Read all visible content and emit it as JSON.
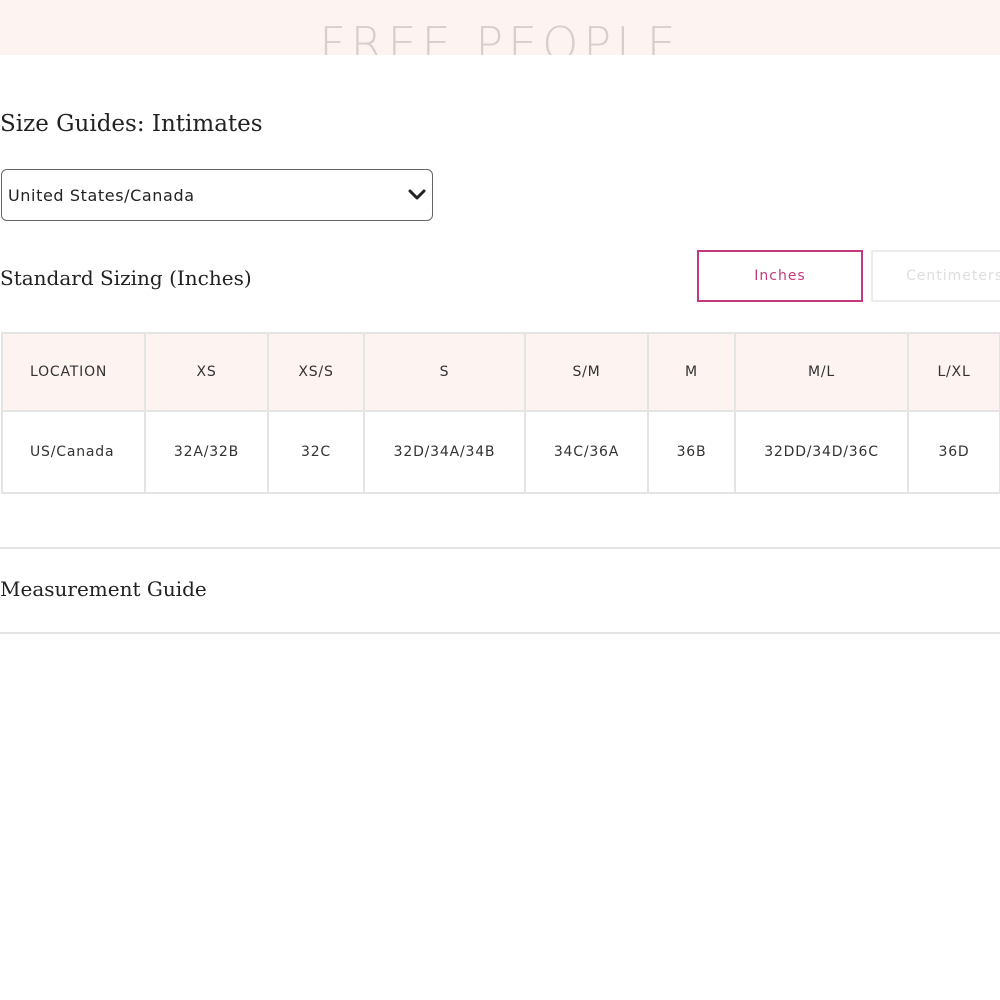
{
  "header": {
    "brand": "FREE PEOPLE"
  },
  "page": {
    "title": "Size Guides: Intimates"
  },
  "region_select": {
    "selected": "United States/Canada",
    "icon": "chevron-down-icon"
  },
  "sizing": {
    "section_title": "Standard Sizing (Inches)",
    "units": [
      {
        "label": "Inches",
        "active": true
      },
      {
        "label": "Centimeters",
        "active": false
      }
    ],
    "accent_color": "#c43a7e",
    "header_bg": "#fdf3f1"
  },
  "table": {
    "columns": [
      "LOCATION",
      "XS",
      "XS/S",
      "S",
      "S/M",
      "M",
      "M/L",
      "L/XL"
    ],
    "rows": [
      [
        "US/Canada",
        "32A/32B",
        "32C",
        "32D/34A/34B",
        "34C/36A",
        "36B",
        "32DD/34D/36C",
        "36D"
      ]
    ]
  },
  "measurement": {
    "title": "Measurement Guide"
  }
}
